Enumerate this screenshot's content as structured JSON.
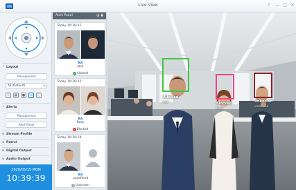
{
  "window": {
    "title": "Live View",
    "controls": [
      "?",
      "—",
      "□",
      "✕"
    ]
  },
  "left_panel": {
    "layout": {
      "label": "Layout",
      "management_button": "Management",
      "select_value": "All (Default)"
    },
    "alerts": {
      "label": "Alerts",
      "management_button": "Management",
      "alert_panel_button": "Alert Panel"
    },
    "sections": [
      "Stream Profile",
      "Patrol",
      "Digital Output",
      "Audio Output"
    ],
    "clock": {
      "date": "2020/05/15 MON",
      "time": "10:39:39"
    }
  },
  "alert_panel": {
    "title": "Alert Panel",
    "cards": [
      {
        "time": "Today 10:39:31",
        "camera": "BA",
        "name": "Jack",
        "status": "Allowed",
        "status_color": "#3aa64a"
      },
      {
        "time": "Today 10:39:25",
        "camera": "BA",
        "name": "Rose",
        "status": "Blocked",
        "status_color": "#e03838"
      },
      {
        "time": "Today 10:39:18",
        "camera": "BA",
        "name": "undefined",
        "status": "Unknown",
        "status_color": "#9aa3ad"
      }
    ]
  },
  "live_view": {
    "detections": [
      {
        "label": "Allowed",
        "name": "Jack",
        "color": "#3ec743"
      },
      {
        "label": "Blocked",
        "name": "Rose",
        "color": "#ff3d8b"
      },
      {
        "label": "Unknown",
        "name": "undefined",
        "color": "#8a1f28"
      }
    ]
  }
}
